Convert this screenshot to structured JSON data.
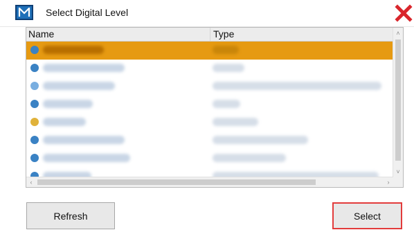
{
  "window": {
    "title": "Select Digital Level",
    "app_icon": "m-logo-icon",
    "close_icon": "close-x-icon"
  },
  "list": {
    "columns": [
      "Name",
      "Type"
    ],
    "rows": [
      {
        "name": "",
        "type": "",
        "selected": true,
        "icon_color": "#3a82c4"
      },
      {
        "name": "",
        "type": "",
        "selected": false,
        "icon_color": "#3a82c4"
      },
      {
        "name": "",
        "type": "",
        "selected": false,
        "icon_color": "#79aee0"
      },
      {
        "name": "",
        "type": "",
        "selected": false,
        "icon_color": "#3a82c4"
      },
      {
        "name": "",
        "type": "",
        "selected": false,
        "icon_color": "#e0b23a"
      },
      {
        "name": "",
        "type": "",
        "selected": false,
        "icon_color": "#3a82c4"
      },
      {
        "name": "",
        "type": "",
        "selected": false,
        "icon_color": "#3a82c4"
      },
      {
        "name": "",
        "type": "",
        "selected": false,
        "icon_color": "#3a82c4"
      }
    ]
  },
  "buttons": {
    "refresh": "Refresh",
    "select": "Select"
  },
  "colors": {
    "selection": "#e69a12",
    "highlight_border": "#e23b3b",
    "app_icon": "#1e6fb8",
    "close_x": "#d9262c"
  }
}
